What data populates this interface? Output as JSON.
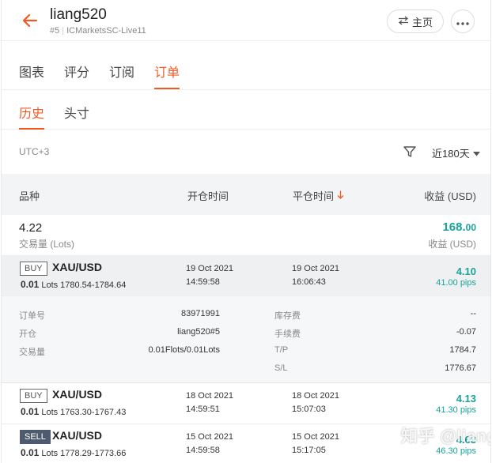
{
  "header": {
    "title": "liang520",
    "account_index": "#5",
    "server": "ICMarketsSC-Live11",
    "home_label": "主页"
  },
  "tabs": [
    {
      "label": "图表",
      "active": false
    },
    {
      "label": "评分",
      "active": false
    },
    {
      "label": "订阅",
      "active": false
    },
    {
      "label": "订单",
      "active": true
    }
  ],
  "subtabs": [
    {
      "label": "历史",
      "active": true
    },
    {
      "label": "头寸",
      "active": false
    }
  ],
  "filter": {
    "timezone": "UTC+3",
    "range": "近180天"
  },
  "columns": {
    "symbol": "品种",
    "open_time": "开仓时间",
    "close_time": "平仓时间",
    "profit": "收益 (USD)"
  },
  "summary": {
    "lots": "4.22",
    "lots_label": "交易量 (Lots)",
    "profit_int": "168.",
    "profit_dec": "00",
    "profit_label": "收益 (USD)"
  },
  "orders": [
    {
      "side": "BUY",
      "symbol": "XAU/USD",
      "lots": "0.01",
      "lots_label": "Lots",
      "prices": "1780.54-1784.64",
      "open_date": "19 Oct 2021",
      "open_time": "14:59:58",
      "close_date": "19 Oct 2021",
      "close_time": "16:06:43",
      "profit": "4.10",
      "pips": "41.00 pips"
    },
    {
      "side": "BUY",
      "symbol": "XAU/USD",
      "lots": "0.01",
      "lots_label": "Lots",
      "prices": "1763.30-1767.43",
      "open_date": "18 Oct 2021",
      "open_time": "14:59:51",
      "close_date": "18 Oct 2021",
      "close_time": "15:07:03",
      "profit": "4.13",
      "pips": "41.30 pips"
    },
    {
      "side": "SELL",
      "symbol": "XAU/USD",
      "lots": "0.01",
      "lots_label": "Lots",
      "prices": "1778.29-1773.66",
      "open_date": "15 Oct 2021",
      "open_time": "14:59:58",
      "close_date": "15 Oct 2021",
      "close_time": "15:17:05",
      "profit": "4.63",
      "pips": "46.30 pips"
    }
  ],
  "detail": {
    "order_no_label": "订单号",
    "order_no": "83971991",
    "open_label": "开仓",
    "open_value": "liang520#5",
    "volume_label": "交易量",
    "volume_value": "0.01Flots/0.01Lots",
    "swap_label": "库存费",
    "swap_value": "--",
    "commission_label": "手续费",
    "commission_value": "-0.07",
    "tp_label": "T/P",
    "tp_value": "1784.7",
    "sl_label": "S/L",
    "sl_value": "1776.67"
  },
  "watermark": "知乎 @liang520",
  "colors": {
    "accent": "#f15a24",
    "profit": "#19a39a",
    "sell_badge": "#4e5b6e"
  }
}
